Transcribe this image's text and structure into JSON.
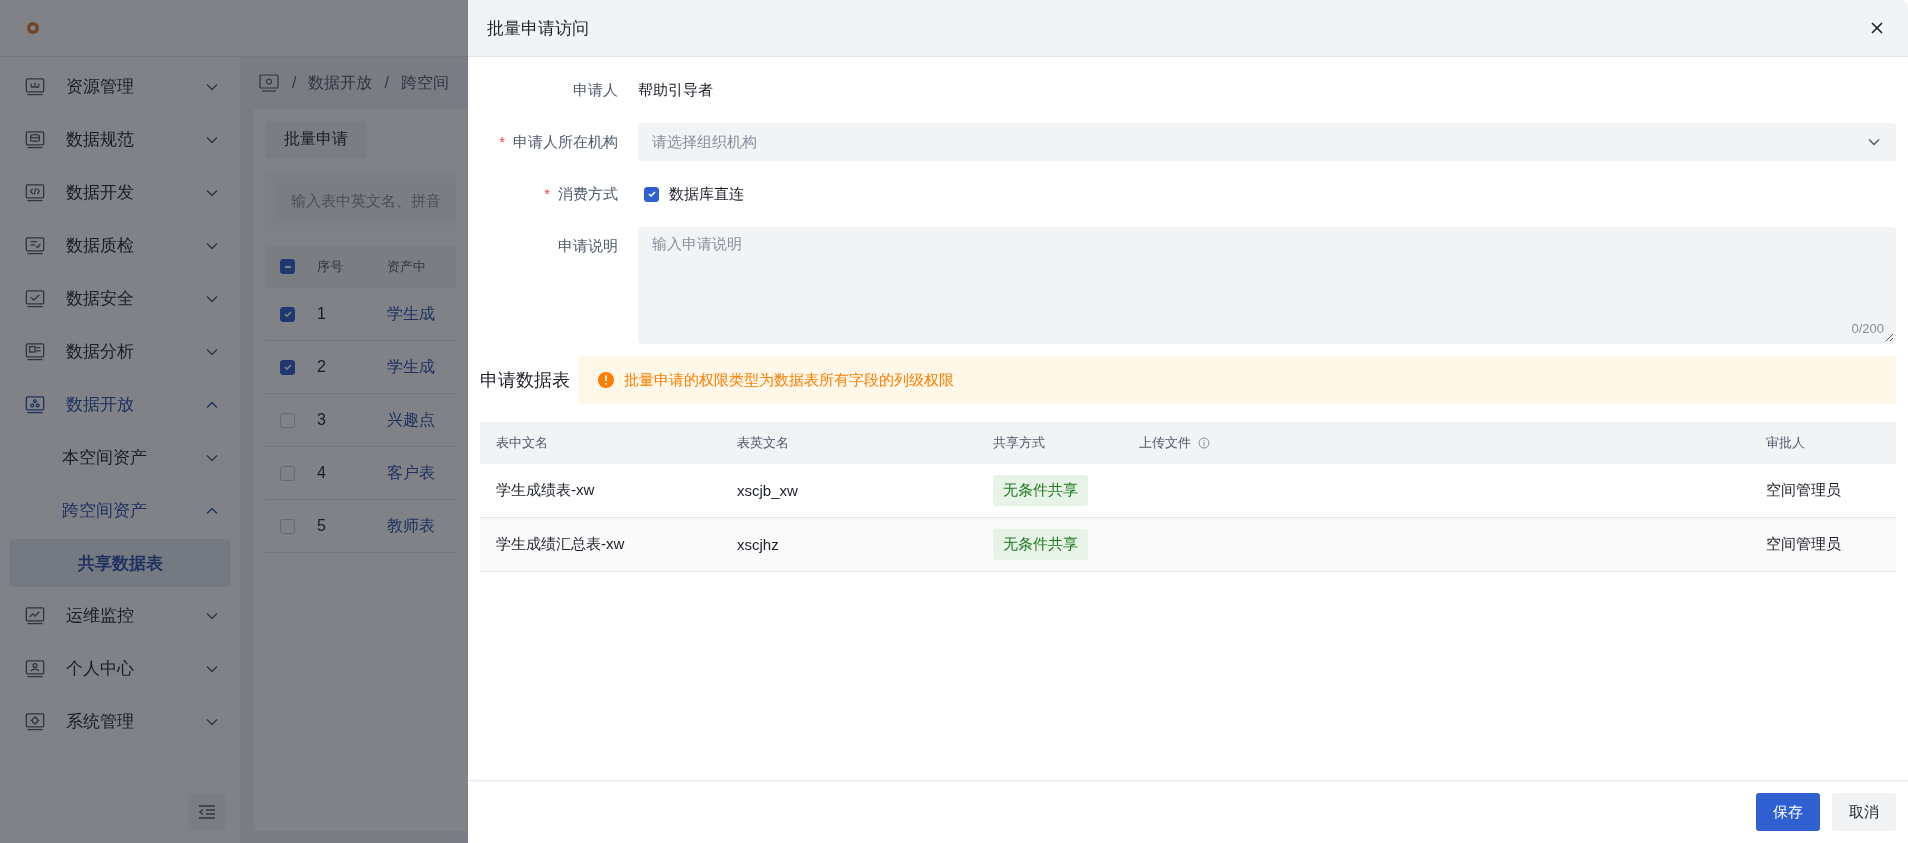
{
  "sidebar": {
    "items": [
      {
        "label": "资源管理",
        "expanded": false,
        "selected": false
      },
      {
        "label": "数据规范",
        "expanded": false,
        "selected": false
      },
      {
        "label": "数据开发",
        "expanded": false,
        "selected": false
      },
      {
        "label": "数据质检",
        "expanded": false,
        "selected": false
      },
      {
        "label": "数据安全",
        "expanded": false,
        "selected": false
      },
      {
        "label": "数据分析",
        "expanded": false,
        "selected": false
      },
      {
        "label": "数据开放",
        "expanded": true,
        "selected": true,
        "children": [
          {
            "label": "本空间资产",
            "expanded": false,
            "selected": false
          },
          {
            "label": "跨空间资产",
            "expanded": true,
            "selected": true,
            "children": [
              {
                "label": "共享数据表",
                "selected": true
              }
            ]
          }
        ]
      },
      {
        "label": "运维监控",
        "expanded": false,
        "selected": false
      },
      {
        "label": "个人中心",
        "expanded": false,
        "selected": false
      },
      {
        "label": "系统管理",
        "expanded": false,
        "selected": false
      }
    ]
  },
  "breadcrumb": [
    {
      "separator": "/",
      "label": "数据开放"
    },
    {
      "separator": "/",
      "label": "跨空间"
    }
  ],
  "page": {
    "batch_button": "批量申请",
    "search": {
      "placeholder": "输入表中英文名、拼音"
    },
    "table": {
      "select_all": {
        "indeterminate": true
      },
      "columns": [
        "序号",
        "资产中"
      ],
      "rows": [
        {
          "checked": true,
          "index": "1",
          "name": "学生成"
        },
        {
          "checked": true,
          "index": "2",
          "name": "学生成"
        },
        {
          "checked": false,
          "index": "3",
          "name": "兴趣点"
        },
        {
          "checked": false,
          "index": "4",
          "name": "客户表"
        },
        {
          "checked": false,
          "index": "5",
          "name": "教师表"
        }
      ]
    }
  },
  "dialog": {
    "title": "批量申请访问",
    "form": [
      {
        "kind": "text",
        "label": "申请人",
        "value": "帮助引导者"
      },
      {
        "kind": "select",
        "label": "申请人所在机构",
        "required_mark": "*",
        "placeholder": "请选择组织机构"
      },
      {
        "kind": "checkbox",
        "label": "消费方式",
        "required_mark": "*",
        "option": "数据库直连",
        "checked": true
      },
      {
        "kind": "textarea",
        "label": "申请说明",
        "placeholder": "输入申请说明",
        "counter": "0/200"
      }
    ],
    "section_title": "申请数据表",
    "alert": "批量申请的权限类型为数据表所有字段的列级权限",
    "table": {
      "columns": [
        {
          "label": "表中文名",
          "hint": false
        },
        {
          "label": "表英文名",
          "hint": false
        },
        {
          "label": "共享方式",
          "hint": false
        },
        {
          "label": "上传文件",
          "hint": true
        },
        {
          "label": "审批人",
          "hint": false
        }
      ],
      "rows": [
        {
          "cn_name": "学生成绩表-xw",
          "en_name": "xscjb_xw",
          "share": "无条件共享",
          "approver": "空间管理员"
        },
        {
          "cn_name": "学生成绩汇总表-xw",
          "en_name": "xscjhz",
          "share": "无条件共享",
          "approver": "空间管理员"
        }
      ]
    },
    "buttons": [
      {
        "label": "保存",
        "kind": "primary"
      },
      {
        "label": "取消",
        "kind": "default"
      }
    ]
  }
}
